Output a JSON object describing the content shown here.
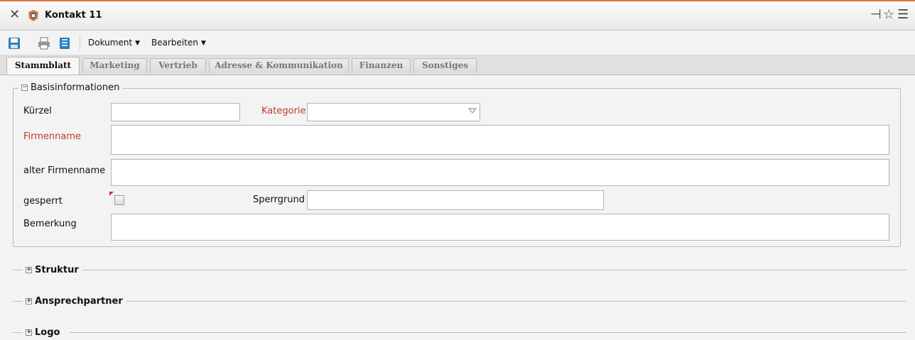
{
  "window": {
    "title": "Kontakt 11"
  },
  "toolbar": {
    "menu_document": "Dokument",
    "menu_edit": "Bearbeiten"
  },
  "tabs": [
    {
      "label": "Stammblatt",
      "active": true
    },
    {
      "label": "Marketing"
    },
    {
      "label": "Vertrieb"
    },
    {
      "label": "Adresse & Kommunikation"
    },
    {
      "label": "Finanzen"
    },
    {
      "label": "Sonstiges"
    }
  ],
  "basis": {
    "legend": "Basisinformationen",
    "fields": {
      "kuerzel": {
        "label": "Kürzel",
        "value": ""
      },
      "kategorie": {
        "label": "Kategorie",
        "value": ""
      },
      "firmenname": {
        "label": "Firmenname",
        "value": ""
      },
      "alter_firmenname": {
        "label": "alter Firmenname",
        "value": ""
      },
      "gesperrt": {
        "label": "gesperrt",
        "checked": false
      },
      "sperrgrund": {
        "label": "Sperrgrund",
        "value": ""
      },
      "bemerkung": {
        "label": "Bemerkung",
        "value": ""
      }
    }
  },
  "sections": [
    {
      "label": "Struktur"
    },
    {
      "label": "Ansprechpartner"
    },
    {
      "label": "Logo"
    }
  ],
  "colors": {
    "accent": "#e3703a",
    "required": "#c0392b"
  }
}
